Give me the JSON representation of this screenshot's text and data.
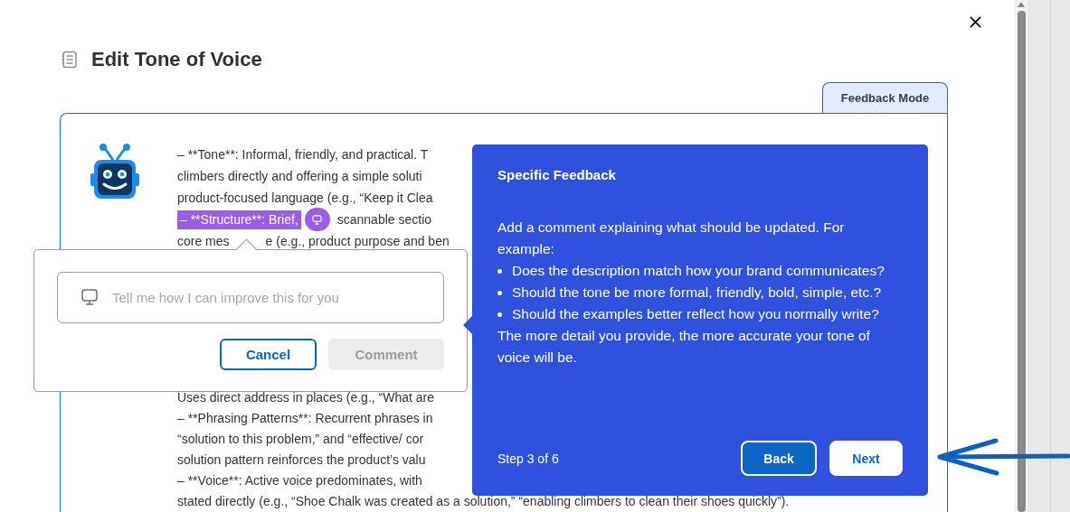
{
  "header": {
    "title": "Edit Tone of Voice"
  },
  "mode_tab": {
    "label": "Feedback Mode",
    "selected": true
  },
  "document": {
    "lines": [
      {
        "kind": "text",
        "text": "– **Tone**: Informal, friendly, and practical. T"
      },
      {
        "kind": "text",
        "text": "climbers directly and offering a simple soluti"
      },
      {
        "kind": "text",
        "text": "product-focused language (e.g., “Keep it Clea"
      },
      {
        "kind": "highlight",
        "highlighted": "– **Structure**: Brief,",
        "rest": "scannable sectio"
      },
      {
        "kind": "split",
        "before": "core mes",
        "after": "e (e.g., product purpose and ben"
      },
      {
        "kind": "hidden"
      },
      {
        "kind": "text",
        "text": "Uses direct address in places (e.g., “What are"
      },
      {
        "kind": "text",
        "text": "– **Phrasing Patterns**: Recurrent phrases in"
      },
      {
        "kind": "text",
        "text": "“solution to this problem,” and “effective/ cor"
      },
      {
        "kind": "text",
        "text": "solution pattern reinforces the product’s valu"
      },
      {
        "kind": "text",
        "text": "– **Voice**: Active voice predominates, with"
      },
      {
        "kind": "text",
        "text": "stated directly (e.g., “Shoe Chalk was created as a solution,” “enabling climbers to clean their shoes quickly”)."
      }
    ]
  },
  "comment_popup": {
    "placeholder": "Tell me how I can improve this for you",
    "buttons": [
      {
        "label": "Cancel",
        "disabled": false
      },
      {
        "label": "Comment",
        "disabled": true
      }
    ]
  },
  "tour": {
    "title": "Specific Feedback",
    "intro": "Add a comment explaining what should be updated. For example:",
    "bullets": [
      "Does the description match how your brand communicates?",
      "Should the tone be more formal, friendly, bold, simple, etc.?",
      "Should the examples better reflect how you normally write?"
    ],
    "closing": "The more detail you provide, the more accurate your tone of voice will be.",
    "step": "Step 3 of 6",
    "buttons": [
      {
        "label": "Back",
        "kind": "secondary"
      },
      {
        "label": "Next",
        "kind": "primary"
      }
    ]
  }
}
